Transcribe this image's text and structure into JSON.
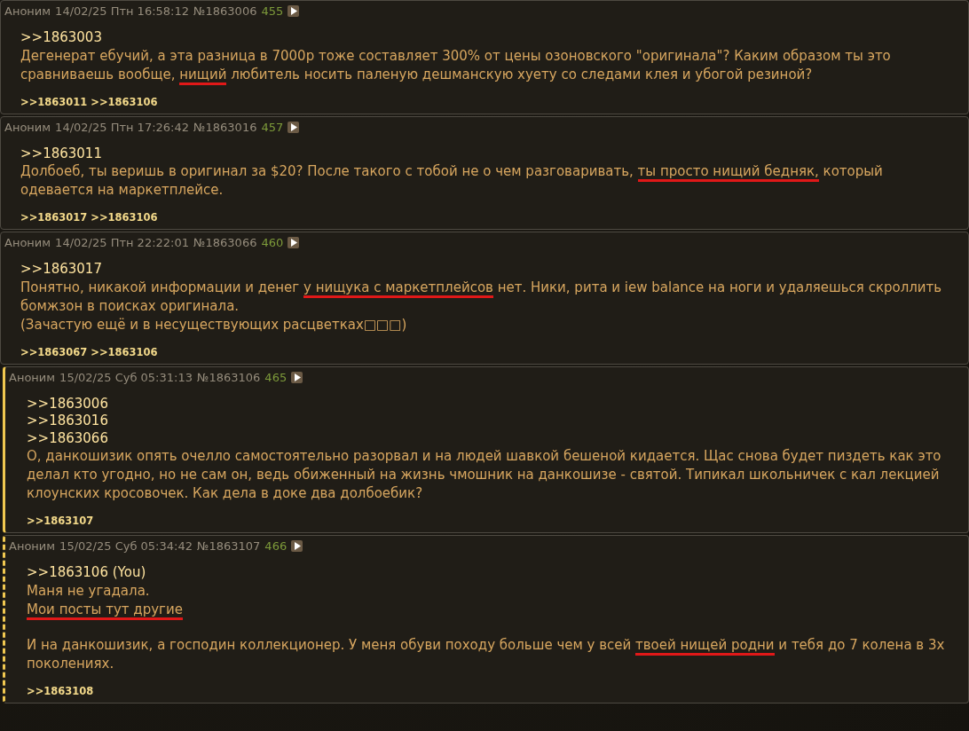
{
  "posts": [
    {
      "kind": "plain",
      "author": "Аноним",
      "date": "14/02/25 Птн 16:58:12",
      "number": "№1863006",
      "count": "455",
      "body": [
        {
          "kind": "link",
          "text": ">>1863003"
        },
        {
          "kind": "text",
          "segments": [
            {
              "text": "Дегенерат ебучий, а эта разница в 7000р тоже составляет 300% от цены озоновского \"оригинала\"? Каким образом ты это сравниваешь вообще, ",
              "underlined": false
            },
            {
              "text": "нищий",
              "underlined": true
            },
            {
              "text": " любитель носить паленую дешманскую хуету со следами клея и убогой резиной?",
              "underlined": false
            }
          ]
        }
      ],
      "replies": [
        ">>1863011",
        ">>1863106"
      ]
    },
    {
      "kind": "plain",
      "author": "Аноним",
      "date": "14/02/25 Птн 17:26:42",
      "number": "№1863016",
      "count": "457",
      "body": [
        {
          "kind": "link",
          "text": ">>1863011"
        },
        {
          "kind": "text",
          "segments": [
            {
              "text": "Долбоеб, ты веришь в оригинал за $20? После такого с тобой не о чем разговаривать, ",
              "underlined": false
            },
            {
              "text": "ты просто нищий бедняк,",
              "underlined": true
            },
            {
              "text": " который одевается на маркетплейсе.",
              "underlined": false
            }
          ]
        }
      ],
      "replies": [
        ">>1863017",
        ">>1863106"
      ]
    },
    {
      "kind": "plain",
      "author": "Аноним",
      "date": "14/02/25 Птн 22:22:01",
      "number": "№1863066",
      "count": "460",
      "body": [
        {
          "kind": "link",
          "text": ">>1863017"
        },
        {
          "kind": "text",
          "segments": [
            {
              "text": "Понятно, никакой информации и денег ",
              "underlined": false
            },
            {
              "text": "у нищука с маркетплейсов",
              "underlined": true
            },
            {
              "text": " нет. Ники, рита и iew balance на ноги и удаляешься скроллить бомжзон в поисках оригинала.",
              "underlined": false
            }
          ]
        },
        {
          "kind": "text",
          "segments": [
            {
              "text": "(Зачастую ещё и в несуществующих расцветках□□□)",
              "underlined": false
            }
          ]
        }
      ],
      "replies": [
        ">>1863067",
        ">>1863106"
      ]
    },
    {
      "kind": "reply",
      "author": "Аноним",
      "date": "15/02/25 Суб 05:31:13",
      "number": "№1863106",
      "count": "465",
      "body": [
        {
          "kind": "link",
          "text": ">>1863006"
        },
        {
          "kind": "link",
          "text": ">>1863016"
        },
        {
          "kind": "link",
          "text": ">>1863066"
        },
        {
          "kind": "text",
          "segments": [
            {
              "text": "О, данкошизик опять очелло самостоятельно разорвал и на людей шавкой бешеной кидается. Щас снова будет пиздеть как это делал кто угодно, но не сам он, ведь обиженный на жизнь чмошник на данкошизе - святой. Типикал школьничек с кал лекцией клоунских кросовочек. Как дела в доке два долбоебик?",
              "underlined": false
            }
          ]
        }
      ],
      "replies": [
        ">>1863107"
      ]
    },
    {
      "kind": "own",
      "author": "Аноним",
      "date": "15/02/25 Суб 05:34:42",
      "number": "№1863107",
      "count": "466",
      "body": [
        {
          "kind": "link",
          "text": ">>1863106 (You)"
        },
        {
          "kind": "text",
          "segments": [
            {
              "text": "Маня не угадала.",
              "underlined": false
            }
          ]
        },
        {
          "kind": "text",
          "segments": [
            {
              "text": "Мои посты тут другие",
              "underlined": true
            }
          ]
        },
        {
          "kind": "break"
        },
        {
          "kind": "text",
          "segments": [
            {
              "text": "И на данкошизик, а господин коллекционер. У меня обуви походу больше чем у всей ",
              "underlined": false
            },
            {
              "text": "твоей нищей родни",
              "underlined": true
            },
            {
              "text": " и тебя до 7 колена в 3х поколениях.",
              "underlined": false
            }
          ]
        }
      ],
      "replies": [
        ">>1863108"
      ]
    }
  ]
}
